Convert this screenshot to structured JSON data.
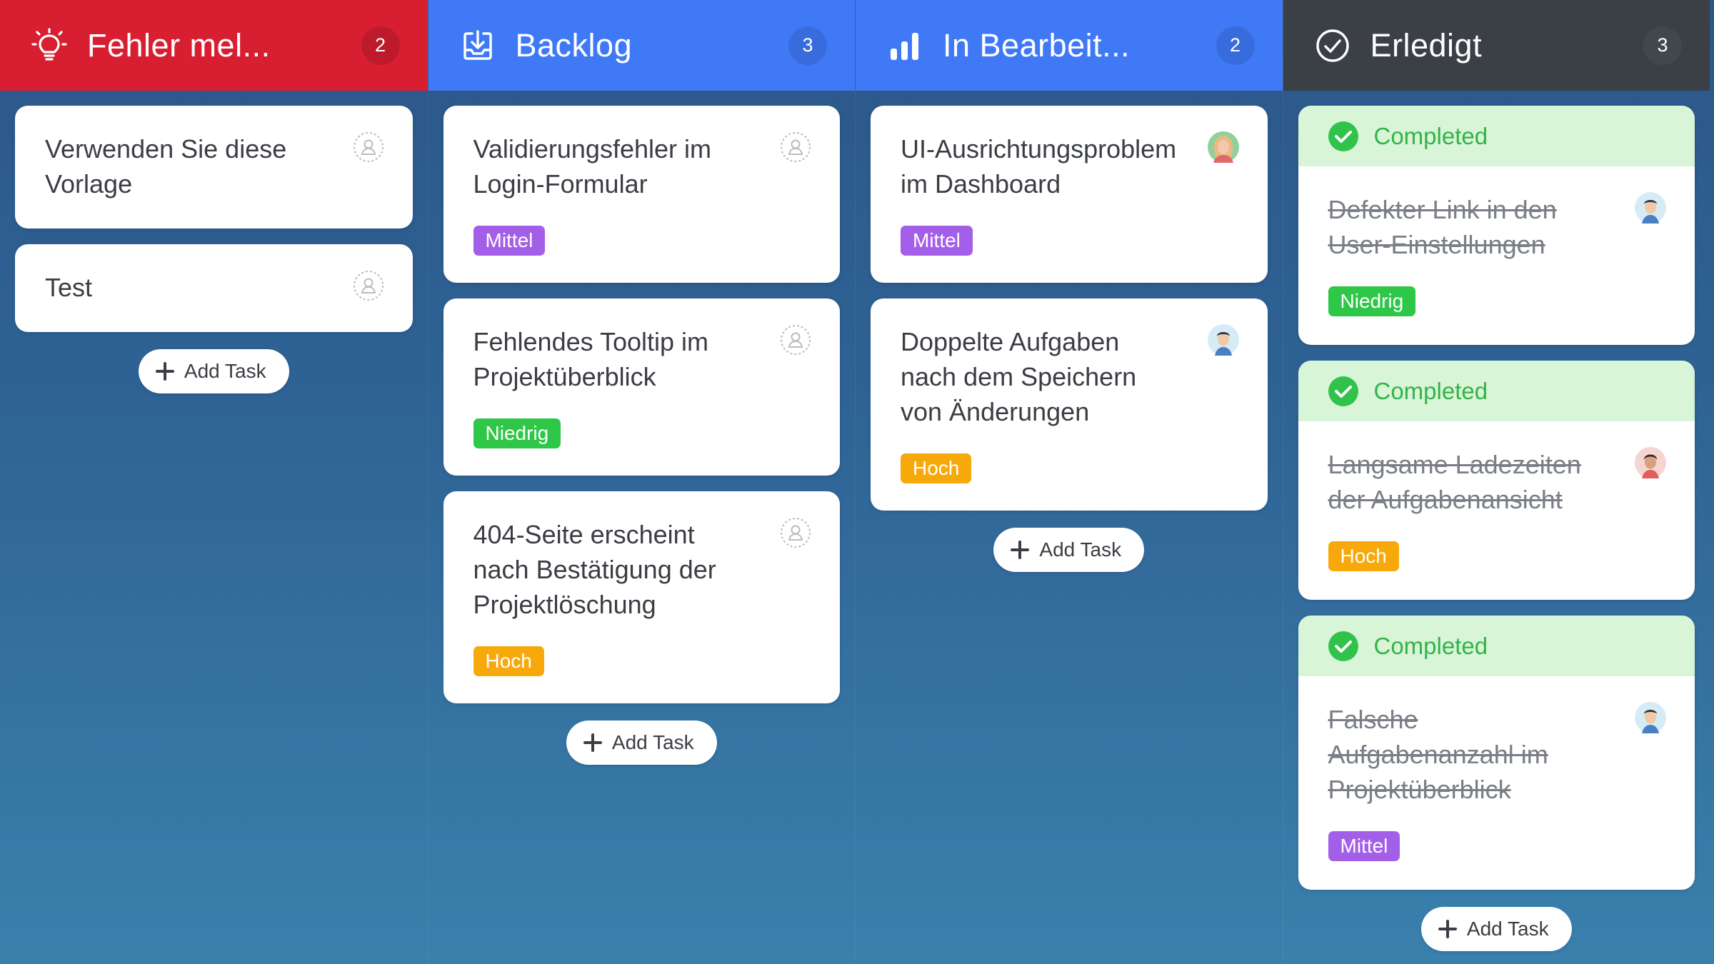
{
  "colors": {
    "bugs_header": "#d81f32",
    "backlog_header": "#3f79f6",
    "progress_header": "#3f79f6",
    "done_header": "#3b3f46",
    "tag_mittel": "#a35fe8",
    "tag_niedrig": "#2fc748",
    "tag_hoch": "#f7a90c",
    "completed_banner": "#d9f5d8",
    "completed_text": "#33b348"
  },
  "columns": [
    {
      "title": "Fehler mel...",
      "count": "2",
      "icon": "lightbulb-icon",
      "cards": [
        {
          "title": "Verwenden Sie diese Vorlage",
          "avatar": "unassigned-user-icon"
        },
        {
          "title": "Test",
          "avatar": "unassigned-user-icon"
        }
      ],
      "add_label": "Add Task"
    },
    {
      "title": "Backlog",
      "count": "3",
      "icon": "inbox-download-icon",
      "cards": [
        {
          "title": "Validierungsfehler im Login-Formular",
          "tag": "Mittel",
          "avatar": "unassigned-user-icon"
        },
        {
          "title": "Fehlendes Tooltip im Projektüberblick",
          "tag": "Niedrig",
          "avatar": "unassigned-user-icon"
        },
        {
          "title": "404-Seite erscheint nach Bestätigung der Projektlöschung",
          "tag": "Hoch",
          "avatar": "unassigned-user-icon"
        }
      ],
      "add_label": "Add Task"
    },
    {
      "title": "In Bearbeit...",
      "count": "2",
      "icon": "bar-chart-icon",
      "cards": [
        {
          "title": "UI-Ausrichtungsproblem im Dashboard",
          "tag": "Mittel",
          "avatar": "user-avatar-woman"
        },
        {
          "title": "Doppelte Aufgaben nach dem Speichern von Änderungen",
          "tag": "Hoch",
          "avatar": "user-avatar-man"
        }
      ],
      "add_label": "Add Task"
    },
    {
      "title": "Erledigt",
      "count": "3",
      "icon": "check-circle-icon",
      "completed_label": "Completed",
      "cards": [
        {
          "title": "Defekter Link in den User-Einstellungen",
          "tag": "Niedrig",
          "avatar": "user-avatar-man"
        },
        {
          "title": "Langsame Ladezeiten der Aufgabenansicht",
          "tag": "Hoch",
          "avatar": "user-avatar-man-2"
        },
        {
          "title": "Falsche Aufgabenanzahl im Projektüberblick",
          "tag": "Mittel",
          "avatar": "user-avatar-man"
        }
      ],
      "add_label": "Add Task"
    }
  ]
}
